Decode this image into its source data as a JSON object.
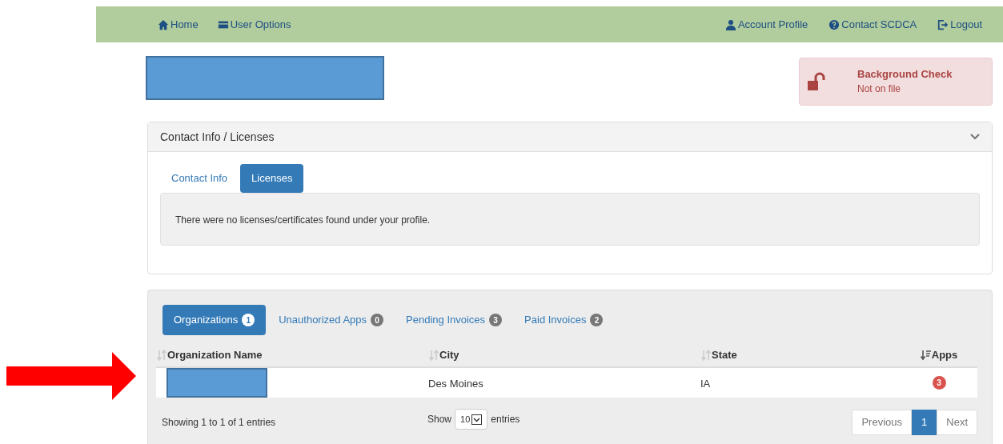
{
  "nav": {
    "left": [
      {
        "label": "Home",
        "kind": "home"
      },
      {
        "label": "User Options",
        "kind": "card"
      }
    ],
    "right": [
      {
        "label": "Account Profile",
        "kind": "user"
      },
      {
        "label": "Contact SCDCA",
        "kind": "help"
      },
      {
        "label": "Logout",
        "kind": "logout"
      }
    ]
  },
  "background_check": {
    "title": "Background Check",
    "status": "Not on file"
  },
  "contact_panel": {
    "title": "Contact Info / Licenses",
    "expanded": true,
    "tabs": [
      {
        "label": "Contact Info",
        "selected": false
      },
      {
        "label": "Licenses",
        "selected": true
      }
    ],
    "message": "There were no licenses/certificates found under your profile."
  },
  "org_panel": {
    "tabs": [
      {
        "label": "Organizations",
        "count": "1",
        "selected": true
      },
      {
        "label": "Unauthorized Apps",
        "count": "0",
        "selected": false
      },
      {
        "label": "Pending Invoices",
        "count": "3",
        "selected": false
      },
      {
        "label": "Paid Invoices",
        "count": "2",
        "selected": false
      }
    ],
    "columns": [
      {
        "label": "Organization Name",
        "sorted": false
      },
      {
        "label": "City",
        "sorted": false
      },
      {
        "label": "State",
        "sorted": false
      },
      {
        "label": "Apps",
        "sorted": true
      }
    ],
    "rows": [
      {
        "city": "Des Moines",
        "state": "IA",
        "apps": "3"
      }
    ],
    "info": "Showing 1 to 1 of 1 entries",
    "length": {
      "before": "Show",
      "value": "10",
      "after": "entries"
    },
    "pagination": [
      {
        "label": "Previous",
        "selected": false
      },
      {
        "label": "1",
        "selected": true
      },
      {
        "label": "Next",
        "selected": false
      }
    ]
  }
}
